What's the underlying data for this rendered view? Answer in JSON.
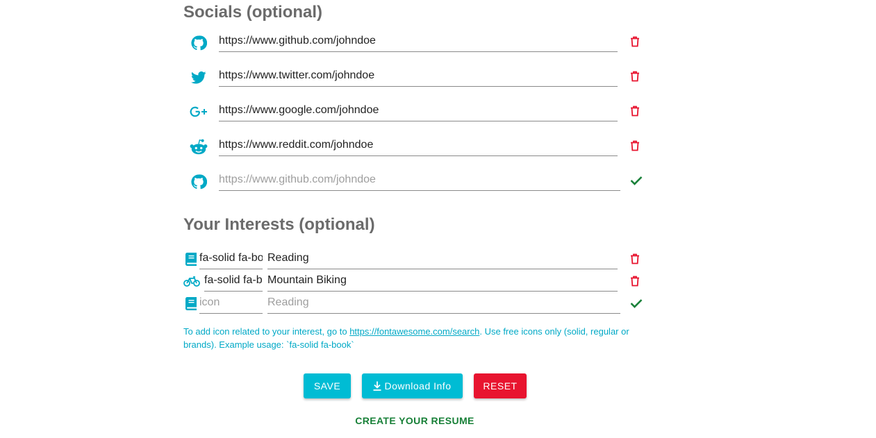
{
  "colors": {
    "accent": "#00bcd4",
    "icon": "#00a9c6",
    "danger": "#e8142f",
    "success": "#188038",
    "heading": "#6b6b6b"
  },
  "socials": {
    "title": "Socials (optional)",
    "items": [
      {
        "icon": "github-icon",
        "value": "https://www.github.com/johndoe",
        "action": "delete-icon"
      },
      {
        "icon": "twitter-icon",
        "value": "https://www.twitter.com/johndoe",
        "action": "delete-icon"
      },
      {
        "icon": "google-plus-icon",
        "value": "https://www.google.com/johndoe",
        "action": "delete-icon"
      },
      {
        "icon": "reddit-icon",
        "value": "https://www.reddit.com/johndoe",
        "action": "delete-icon"
      }
    ],
    "new_item": {
      "icon": "github-icon",
      "placeholder": "https://www.github.com/johndoe",
      "action": "check-icon"
    }
  },
  "interests": {
    "title": "Your Interests (optional)",
    "items": [
      {
        "icon": "book-icon",
        "icon_value": "fa-solid fa-book",
        "value": "Reading",
        "action": "delete-icon"
      },
      {
        "icon": "bicycle-icon",
        "icon_value": "fa-solid fa-bicycle",
        "value": "Mountain Biking",
        "action": "delete-icon"
      }
    ],
    "new_item": {
      "icon": "book-icon",
      "icon_placeholder": "icon",
      "placeholder": "Reading",
      "action": "check-icon"
    },
    "help_before": "To add icon related to your interest, go to ",
    "help_link": "https://fontawesome.com/search",
    "help_after": ". Use free icons only (solid, regular or brands). Example usage: `fa-solid fa-book`"
  },
  "buttons": {
    "save": "SAVE",
    "download": "Download Info",
    "reset": "RESET"
  },
  "create_resume": "CREATE YOUR RESUME"
}
